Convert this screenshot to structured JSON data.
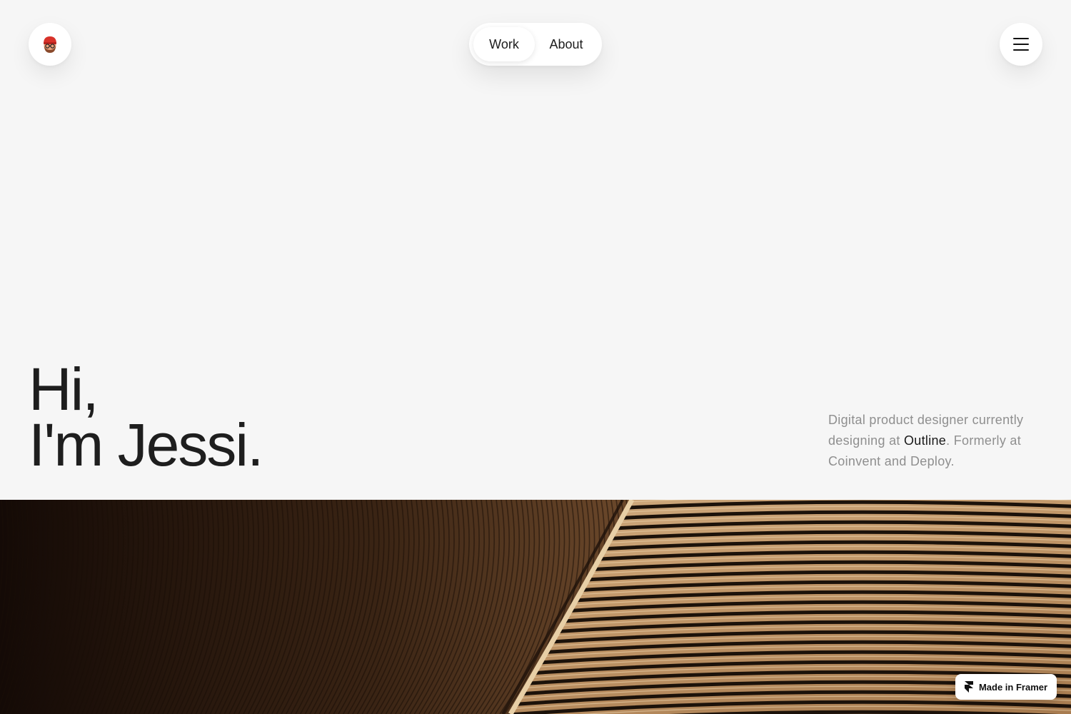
{
  "header": {
    "avatar_icon": "memoji-avatar-icon",
    "nav": {
      "items": [
        {
          "label": "Work",
          "active": true
        },
        {
          "label": "About",
          "active": false
        }
      ]
    },
    "menu_icon": "hamburger-menu-icon"
  },
  "hero": {
    "heading_line1": "Hi,",
    "heading_line2": "I'm Jessi.",
    "bio": {
      "text_before": "Digital product designer currently designing at ",
      "link": "Outline",
      "text_after": ". Formerly at Coinvent and Deploy."
    },
    "image": "architectural-wood-slats-image"
  },
  "badge": {
    "label": "Made in Framer",
    "icon": "framer-logo-icon"
  },
  "colors": {
    "background": "#f6f6f6",
    "text_primary": "#1e1e1e",
    "text_muted": "#8f8f8f",
    "wood_light": "#c9a57c",
    "wood_dark": "#2a1a10"
  }
}
